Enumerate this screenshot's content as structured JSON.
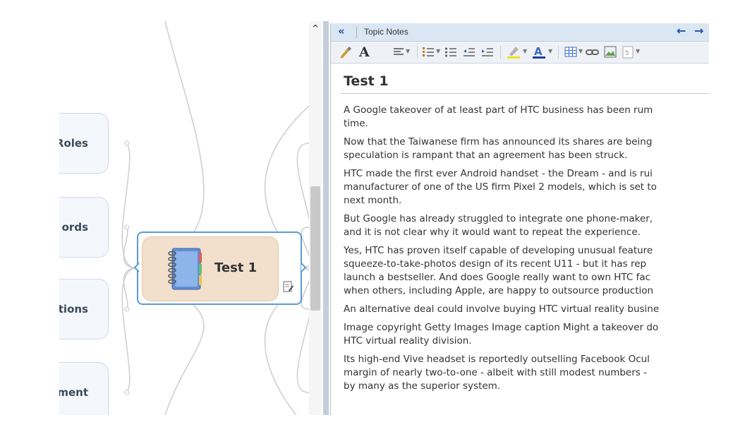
{
  "mindmap": {
    "central_topic": "Test 1",
    "side_topics": [
      "Roles",
      "ords",
      "tions",
      "ment"
    ]
  },
  "notes_panel": {
    "title": "Topic Notes",
    "collapse_glyph": "«",
    "back_glyph": "🡐",
    "forward_glyph": "🡒",
    "toolbar": [
      "format-painter-icon",
      "font-icon",
      "align-icon",
      "numbered-list-icon",
      "bullet-list-icon",
      "decrease-indent-icon",
      "increase-indent-icon",
      "highlight-icon",
      "font-color-icon",
      "table-icon",
      "link-icon",
      "image-icon",
      "more-icon"
    ],
    "accent": "#1f4fa8"
  },
  "note": {
    "title": "Test 1",
    "paragraphs": [
      [
        "A Google takeover of at least part of HTC business has been rum",
        "time."
      ],
      [
        "Now that the Taiwanese firm has announced its shares are being",
        "speculation is rampant that an agreement has been struck."
      ],
      [
        "HTC made the first ever Android handset - the Dream - and is rui",
        "manufacturer of one of the US firm Pixel 2 models, which is set to",
        "next month."
      ],
      [
        "But Google has already struggled to integrate one phone-maker,",
        "and it is not clear why it would want to repeat the experience."
      ],
      [
        "Yes, HTC has proven itself capable of developing unusual feature",
        "squeeze-to-take-photos design of its recent U11 - but it has rep",
        "launch a bestseller. And does Google really want to own HTC fac",
        "when others, including Apple, are happy to outsource production"
      ],
      [
        "An alternative deal could involve buying HTC virtual reality busine"
      ],
      [
        "Image copyright Getty Images Image caption Might a takeover do",
        "HTC virtual reality division."
      ],
      [
        "Its high-end Vive headset is reportedly outselling Facebook Ocul",
        "margin of nearly two-to-one - albeit with still modest numbers -",
        "by many as the superior system."
      ]
    ]
  }
}
